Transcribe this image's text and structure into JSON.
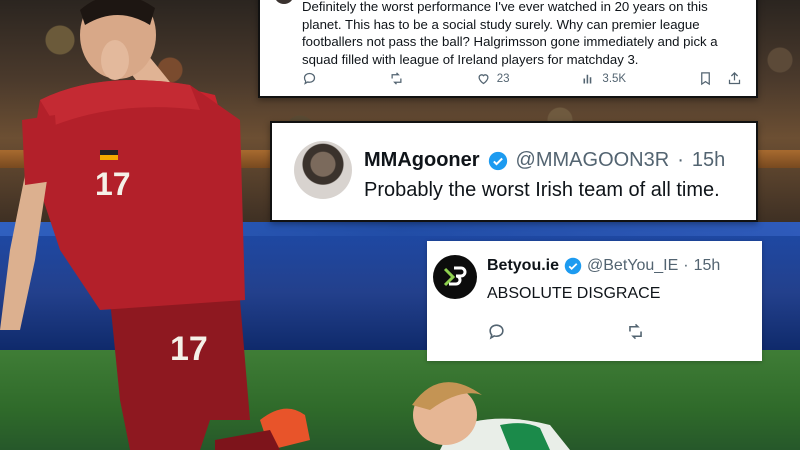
{
  "tweet_top": {
    "text_lines": [
      "Definitely the worst performance I've ever watched in 20 years on this",
      "planet. This has to be a social study surely. Why can premier league",
      "footballers not pass the ball? Halgrimsson gone immediately and pick a",
      "squad filled with league of Ireland players for matchday 3."
    ],
    "actions": {
      "reply_icon": "reply-icon",
      "retweet_icon": "retweet-icon",
      "like_count": "23",
      "views_count": "3.5K",
      "bookmark_icon": "bookmark-icon",
      "share_icon": "share-icon"
    }
  },
  "tweet_mid": {
    "name": "MMAgooner",
    "handle": "@MMAGOON3R",
    "separator": "·",
    "time": "15h",
    "text": "Probably the worst Irish team of all time."
  },
  "tweet_bot": {
    "name": "Betyou.ie",
    "handle": "@BetYou_IE",
    "separator": "·",
    "time": "15h",
    "text": "ABSOLUTE DISGRACE"
  },
  "player": {
    "shirt_number": "17"
  },
  "colors": {
    "verified": "#1d9bf0",
    "muted": "#536471",
    "shirt_red": "#b3202a"
  }
}
